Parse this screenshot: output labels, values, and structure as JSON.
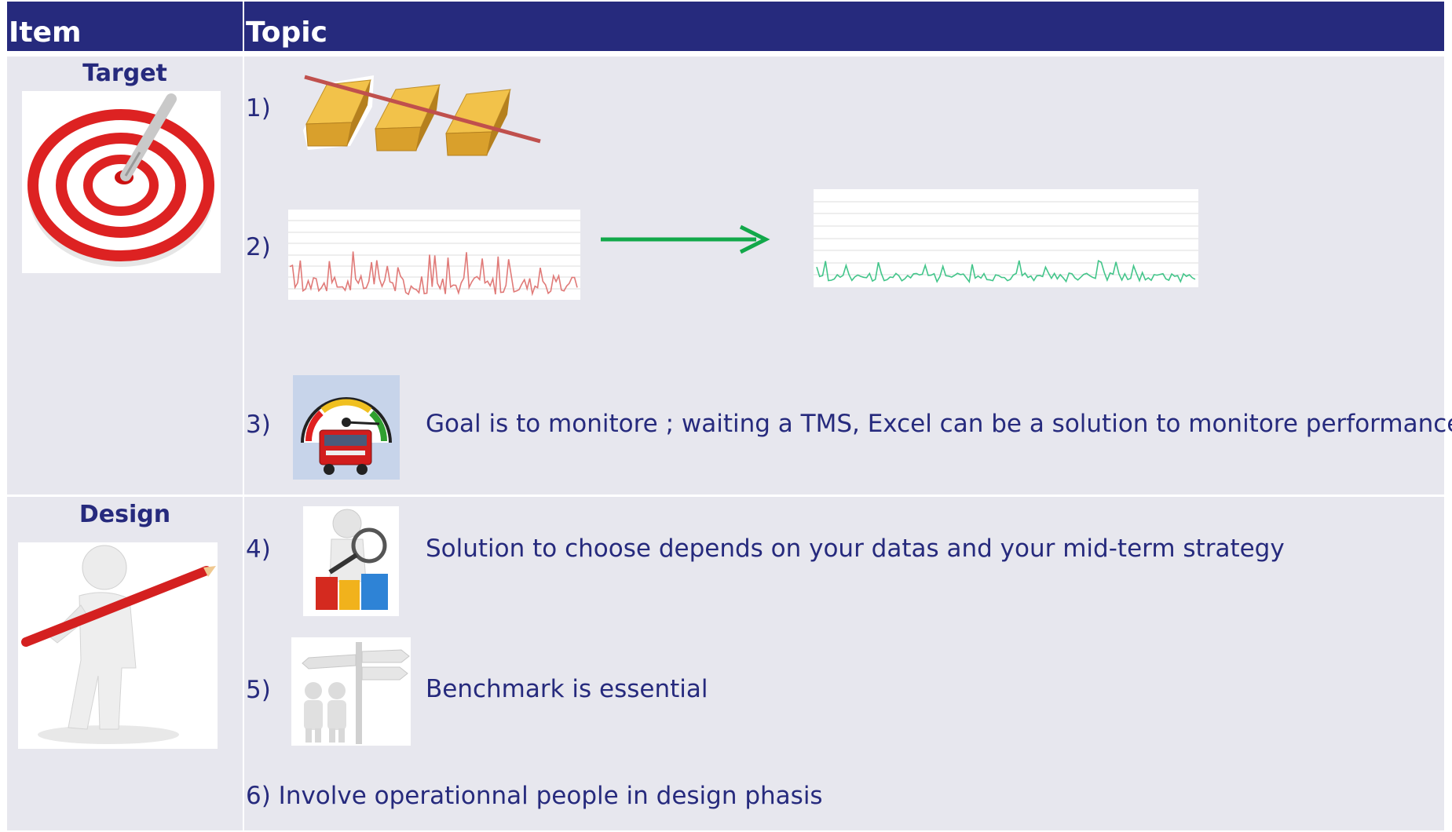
{
  "header": {
    "col_item": "Item",
    "col_topic": "Topic"
  },
  "sections": [
    {
      "item": "Target"
    },
    {
      "item": "Design"
    }
  ],
  "topics": [
    {
      "num": "1)",
      "text": ""
    },
    {
      "num": "2)",
      "text": ""
    },
    {
      "num": "3)",
      "text": "Goal is to monitore ; waiting a TMS, Excel can be a solution to monitore performance"
    },
    {
      "num": "4)",
      "text": "Solution to choose depends on your datas and your mid-term strategy"
    },
    {
      "num": "5)",
      "text": "Benchmark is essential"
    },
    {
      "num": "6)",
      "text": "6) Involve operationnal people in design phasis"
    }
  ],
  "colors": {
    "header_bg": "#262a7d",
    "cell_bg": "#e7e7ee",
    "text": "#262a7d",
    "arrow": "#12a84a",
    "red_line": "#e07a78",
    "green_line": "#43c58a"
  },
  "icons": [
    "target-dart-icon",
    "gold-bars-icon",
    "speedometer-truck-icon",
    "figure-magnifier-icon",
    "figures-signpost-icon",
    "figure-pencil-icon",
    "red-sparkline",
    "green-sparkline",
    "right-arrow-icon"
  ]
}
